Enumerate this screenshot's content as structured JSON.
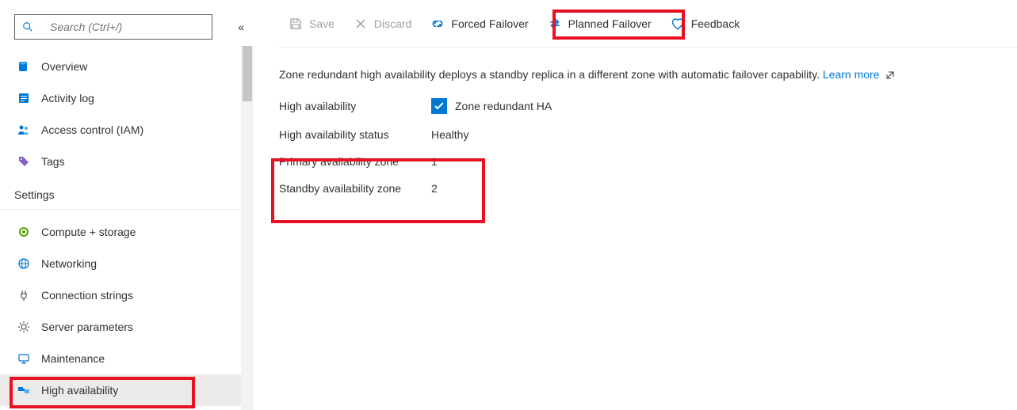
{
  "sidebar": {
    "search_placeholder": "Search (Ctrl+/)",
    "collapse_glyph": "«",
    "items": [
      {
        "label": "Overview"
      },
      {
        "label": "Activity log"
      },
      {
        "label": "Access control (IAM)"
      },
      {
        "label": "Tags"
      }
    ],
    "settings_header": "Settings",
    "settings_items": [
      {
        "label": "Compute + storage"
      },
      {
        "label": "Networking"
      },
      {
        "label": "Connection strings"
      },
      {
        "label": "Server parameters"
      },
      {
        "label": "Maintenance"
      },
      {
        "label": "High availability"
      }
    ]
  },
  "toolbar": {
    "save_label": "Save",
    "discard_label": "Discard",
    "forced_failover_label": "Forced Failover",
    "planned_failover_label": "Planned Failover",
    "feedback_label": "Feedback"
  },
  "main": {
    "description": "Zone redundant high availability deploys a standby replica in a different zone with automatic failover capability.",
    "learn_more": "Learn more",
    "ha_label": "High availability",
    "ha_checkbox_text": "Zone redundant HA",
    "ha_status_label": "High availability status",
    "ha_status_value": "Healthy",
    "primary_zone_label": "Primary availability zone",
    "primary_zone_value": "1",
    "standby_zone_label": "Standby availability zone",
    "standby_zone_value": "2"
  }
}
